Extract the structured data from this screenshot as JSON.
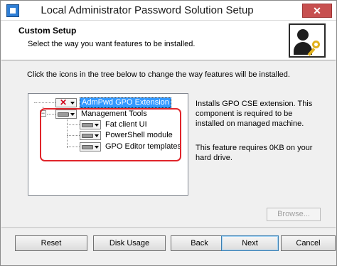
{
  "window": {
    "title": "Local Administrator Password Solution Setup",
    "close_glyph": "✕"
  },
  "header": {
    "title": "Custom Setup",
    "subtitle": "Select the way you want features to be installed."
  },
  "instruction": "Click the icons in the tree below to change the way features will be installed.",
  "tree": {
    "items": [
      {
        "label": "AdmPwd GPO Extension",
        "state": "not-installed",
        "selected": true
      },
      {
        "label": "Management Tools",
        "state": "installed",
        "selected": false,
        "expander": "−"
      },
      {
        "label": "Fat client UI",
        "state": "installed",
        "selected": false
      },
      {
        "label": "PowerShell module",
        "state": "installed",
        "selected": false
      },
      {
        "label": "GPO Editor templates",
        "state": "installed",
        "selected": false
      }
    ]
  },
  "description": {
    "text": "Installs GPO CSE extension. This component is required to be installed on managed machine.",
    "size": "This feature requires 0KB on your hard drive."
  },
  "buttons": {
    "browse": "Browse...",
    "reset": "Reset",
    "disk_usage": "Disk Usage",
    "back": "Back",
    "next": "Next",
    "cancel": "Cancel"
  },
  "colors": {
    "selection": "#3399ff",
    "annotation_box": "#e0242a",
    "x_mark": "#d0021b",
    "key": "#e2b21d"
  }
}
